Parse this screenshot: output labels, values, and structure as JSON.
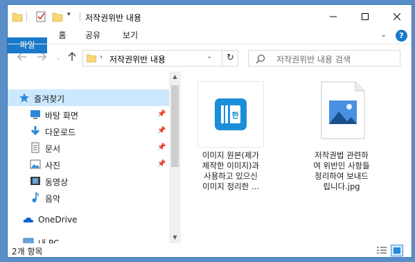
{
  "window": {
    "title": "저작권위반 내용"
  },
  "ribbon": {
    "tabs": [
      "파일",
      "홈",
      "공유",
      "보기"
    ],
    "help": "?"
  },
  "address": {
    "path": "저작권위반 내용"
  },
  "search": {
    "placeholder": "저작권위반 내용 검색"
  },
  "sidebar": {
    "items": [
      {
        "label": "즐겨찾기",
        "icon": "star-icon"
      },
      {
        "label": "바탕 화면",
        "icon": "desktop-icon"
      },
      {
        "label": "다운로드",
        "icon": "download-icon"
      },
      {
        "label": "문서",
        "icon": "document-icon"
      },
      {
        "label": "사진",
        "icon": "pictures-icon"
      },
      {
        "label": "동영상",
        "icon": "videos-icon"
      },
      {
        "label": "음악",
        "icon": "music-icon"
      },
      {
        "label": "OneDrive",
        "icon": "cloud-icon"
      },
      {
        "label": "내 PC",
        "icon": "pc-icon"
      }
    ]
  },
  "files": [
    {
      "name": "이미지 원본(제가\n제작한 이미지)과\n사용하고 있으신\n이미지 정리한 ...",
      "icon": "app-icon"
    },
    {
      "name": "저작권법 관련하\n여 위반인 사항들\n정리하여 보내드\n립니다.jpg",
      "icon": "image-file-icon"
    }
  ],
  "status": {
    "count": "2개 항목"
  },
  "colors": {
    "accent": "#1979ca",
    "selected": "#cce8ff",
    "folder": "#f8d775"
  }
}
